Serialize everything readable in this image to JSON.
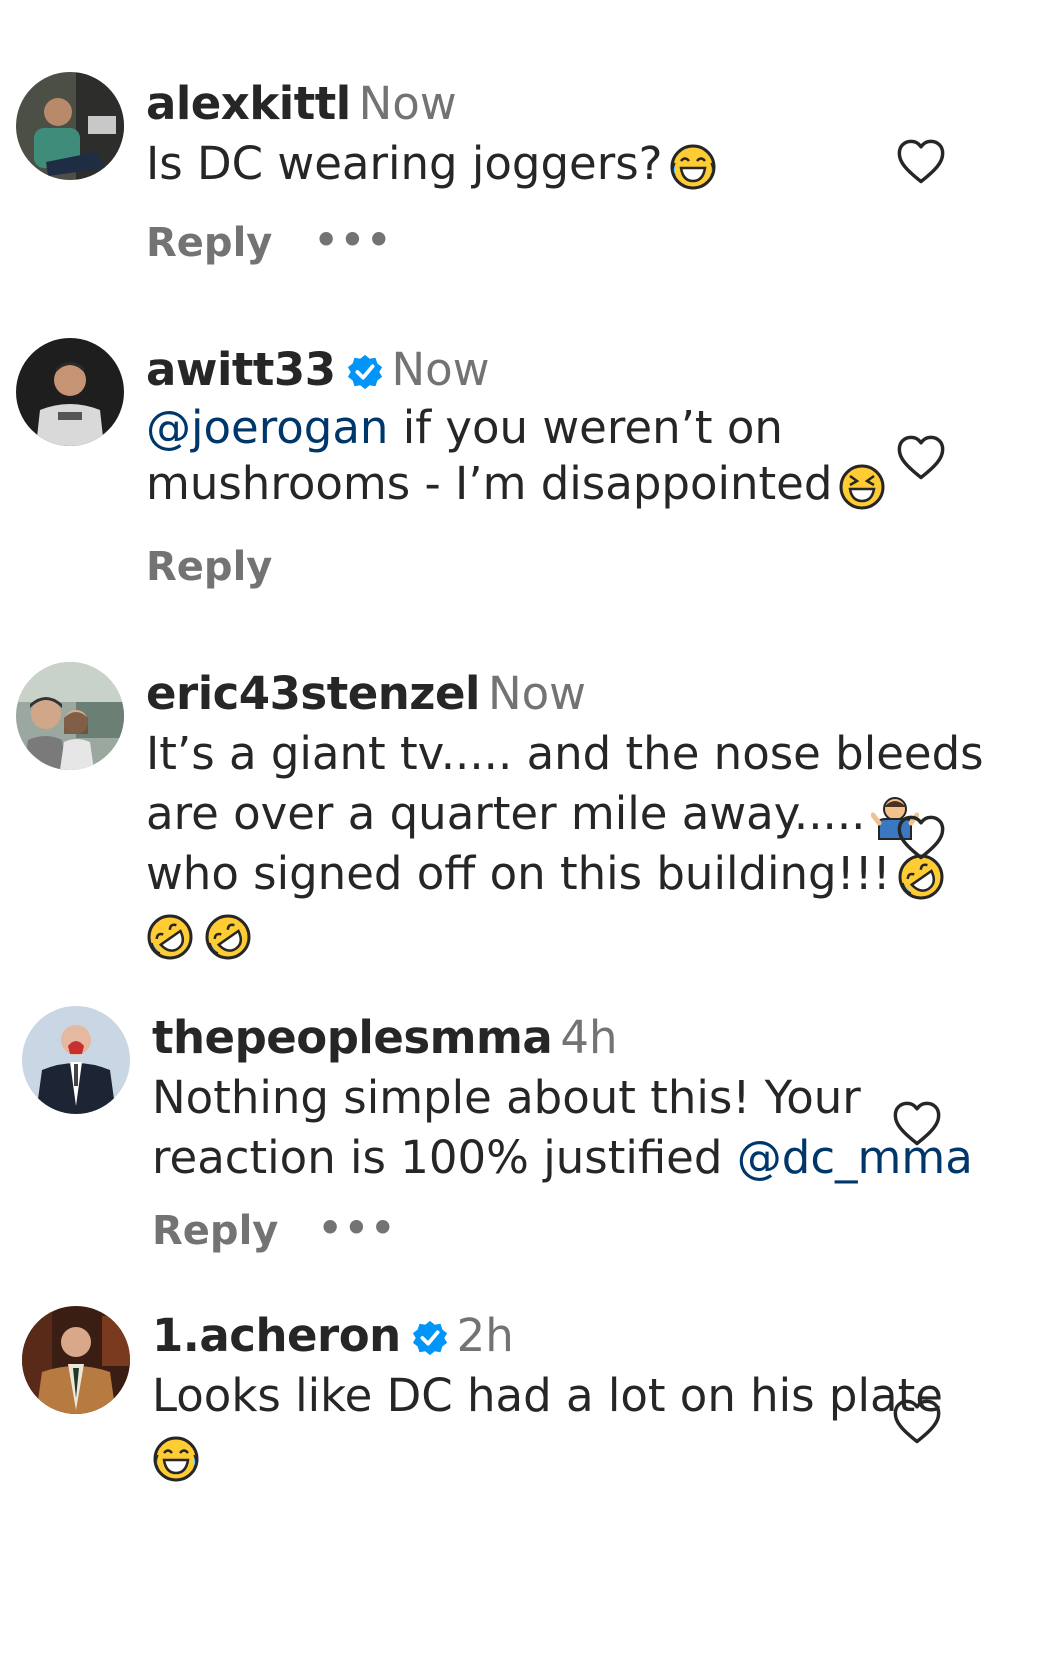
{
  "comments": [
    {
      "handle": "alexkittl",
      "time": "Now",
      "lines": [
        "Is DC wearing joggers?"
      ],
      "reply_label": "Reply",
      "more_label": "•••",
      "emoji": "tears-of-joy"
    },
    {
      "handle": "awitt33",
      "verified": true,
      "time": "Now",
      "mention": "@joerogan",
      "line1_rest": " if you weren’t on",
      "line2": "mushrooms - I’m disappointed",
      "reply_label": "Reply",
      "emoji": "squinting-laugh"
    },
    {
      "handle": "eric43stenzel",
      "time": "Now",
      "lines": [
        "It’s a giant tv..... and the nose bleeds",
        "are over a quarter mile away.....",
        "who signed off on this building!!!"
      ],
      "emoji": [
        "person-shrugging",
        "rolling-laughing",
        "rolling-laughing",
        "rolling-laughing"
      ]
    },
    {
      "handle": "thepeoplesmma",
      "time": "4h",
      "line1": "Nothing simple about this! Your",
      "line2_text": "reaction is 100% justified ",
      "mention": "@dc_mma",
      "reply_label": "Reply",
      "more_label": "•••"
    },
    {
      "handle": "1.acheron",
      "verified": true,
      "time": "2h",
      "lines": [
        "Looks like DC had a lot on his plate"
      ],
      "emoji": "tears-of-joy"
    }
  ],
  "colors": {
    "text": "#262626",
    "muted": "#737373",
    "mention": "#00376b",
    "verified": "#0095f6",
    "emoji": "#ffcc33"
  }
}
